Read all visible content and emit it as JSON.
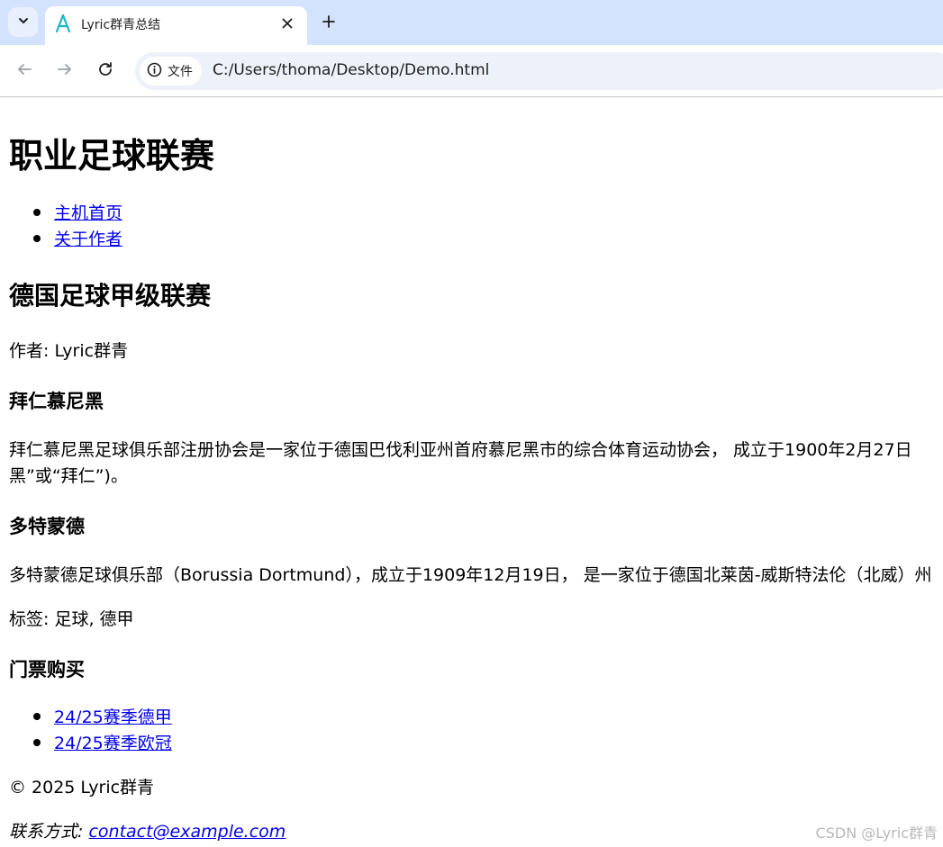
{
  "browser": {
    "tab_title": "Lyric群青总结",
    "site_chip_label": "文件",
    "url": "C:/Users/thoma/Desktop/Demo.html"
  },
  "page": {
    "site_title": "职业足球联赛",
    "nav": [
      {
        "label": "主机首页"
      },
      {
        "label": "关于作者"
      }
    ],
    "article": {
      "title": "德国足球甲级联赛",
      "author_line": "作者: Lyric群青",
      "sections": [
        {
          "heading": "拜仁慕尼黑",
          "body": "拜仁慕尼黑足球俱乐部注册协会是一家位于德国巴伐利亚州首府慕尼黑市的综合体育运动协会， 成立于1900年2月27日",
          "body_wrap": "黑”或“拜仁”)。"
        },
        {
          "heading": "多特蒙德",
          "body": "多特蒙德足球俱乐部（Borussia Dortmund），成立于1909年12月19日， 是一家位于德国北莱茵-威斯特法伦（北威）州"
        }
      ],
      "tags_line": "标签: 足球, 德甲"
    },
    "tickets": {
      "heading": "门票购买",
      "items": [
        {
          "label": "24/25赛季德甲"
        },
        {
          "label": "24/25赛季欧冠"
        }
      ]
    },
    "footer": {
      "copyright": "© 2025 Lyric群青",
      "contact_prefix": "联系方式: ",
      "contact_email": "contact@example.com"
    }
  },
  "watermark": "CSDN @Lyric群青",
  "colors": {
    "tabstrip_bg": "#d3e3fd",
    "link": "#0000ee",
    "favicon": "#1fb6c6"
  }
}
